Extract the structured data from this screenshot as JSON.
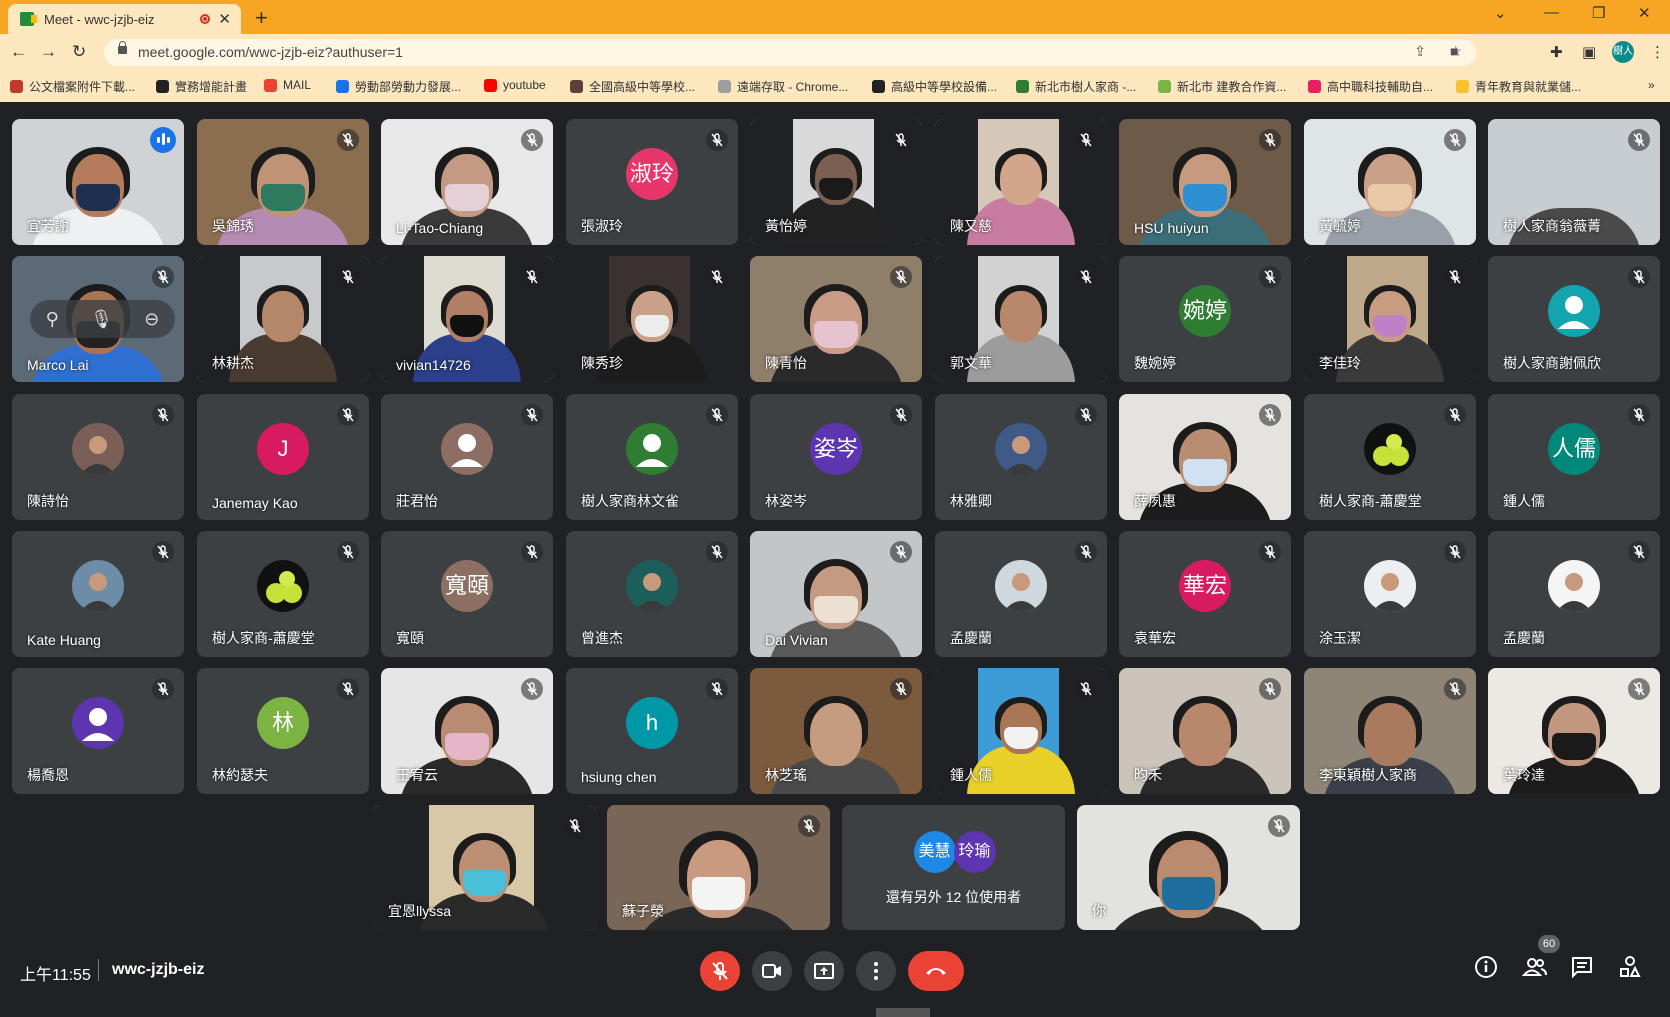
{
  "browser": {
    "tab_title": "Meet - wwc-jzjb-eiz",
    "tab_close": "✕",
    "new_tab": "+",
    "url": "meet.google.com/wwc-jzjb-eiz?authuser=1",
    "profile_initials": "樹人"
  },
  "bookmarks": [
    {
      "label": "公文檔案附件下載...",
      "color": "#c0392b"
    },
    {
      "label": "實務增能計畫",
      "color": "#222222"
    },
    {
      "label": "MAIL",
      "color": "#ea4335"
    },
    {
      "label": "勞動部勞動力發展...",
      "color": "#1a73e8"
    },
    {
      "label": "youtube",
      "color": "#ff0000"
    },
    {
      "label": "全國高級中等學校...",
      "color": "#5d4037"
    },
    {
      "label": "遠端存取 - Chrome...",
      "color": "#9e9e9e"
    },
    {
      "label": "高級中等學校設備...",
      "color": "#222222"
    },
    {
      "label": "新北市樹人家商 -...",
      "color": "#2e7d32"
    },
    {
      "label": "新北市 建教合作資...",
      "color": "#7cb342"
    },
    {
      "label": "高中職科技輔助自...",
      "color": "#e91e63"
    },
    {
      "label": "青年教育與就業儲...",
      "color": "#fbc02d"
    }
  ],
  "participants": [
    {
      "name": "宜芳謝",
      "type": "video",
      "speaking": true,
      "bg": "#cfd3d6",
      "face": "#b47b5c",
      "mask": "#1f2f4f",
      "shirt": "#eef0f2"
    },
    {
      "name": "吳錦琇",
      "type": "video",
      "bg": "#8a6e4f",
      "face": "#c09377",
      "mask": "#2f7a5e",
      "shirt": "#b48bb3"
    },
    {
      "name": "Li-Tao-Chiang",
      "type": "video",
      "bg": "#e8e8e8",
      "face": "#c49a82",
      "mask": "#e6d0d8",
      "shirt": "#3a3a3a"
    },
    {
      "name": "張淑玲",
      "type": "avatar",
      "avatar_text": "淑玲",
      "avatar_color": "#e8366b"
    },
    {
      "name": "黃怡婷",
      "type": "video",
      "bg": "#d9d9d9",
      "face": "#7a5f52",
      "mask": "#1a1a1a",
      "shirt": "#222222",
      "narrow": true
    },
    {
      "name": "陳又慈",
      "type": "video",
      "bg": "#d5c8b8",
      "face": "#d3a68b",
      "mask": "",
      "shirt": "#c87d9f",
      "narrow": true
    },
    {
      "name": "HSU huiyun",
      "type": "video",
      "bg": "#6d5a48",
      "face": "#c59a7f",
      "mask": "#2b8fd1",
      "shirt": "#3c6e7a"
    },
    {
      "name": "黃毓婷",
      "type": "video",
      "bg": "#dfe4e6",
      "face": "#caa088",
      "mask": "#e8c9a6",
      "shirt": "#9aa0a8"
    },
    {
      "name": "樹人家商翁薇菁",
      "type": "video",
      "bg": "#c8cdd2",
      "face": "",
      "mask": "",
      "shirt": "#4a4a4a"
    },
    {
      "name": "Marco Lai",
      "type": "video",
      "bg": "#5c6a78",
      "face": "#a87454",
      "mask": "#222222",
      "shirt": "#2f6fd1",
      "hover": true
    },
    {
      "name": "林耕杰",
      "type": "video",
      "bg": "#c7c9cb",
      "face": "#b4866a",
      "mask": "",
      "shirt": "#4a3b30",
      "narrow": true
    },
    {
      "name": "vivian14726",
      "type": "video",
      "bg": "#dcdcd0",
      "face": "#b07f66",
      "mask": "#111111",
      "shirt": "#2b3f8a",
      "narrow": true
    },
    {
      "name": "陳秀珍",
      "type": "video",
      "bg": "#3a3230",
      "face": "#c9a089",
      "mask": "#ececec",
      "shirt": "#1c1c1c",
      "narrow": true
    },
    {
      "name": "陳青怡",
      "type": "video",
      "bg": "#8f7e6a",
      "face": "#c99c85",
      "mask": "#e7c2cf",
      "shirt": "#2a2a2a"
    },
    {
      "name": "郭文華",
      "type": "video",
      "bg": "#d2d2d2",
      "face": "#b9876c",
      "mask": "",
      "shirt": "#9c9c9c",
      "narrow": true
    },
    {
      "name": "魏婉婷",
      "type": "avatar",
      "avatar_text": "婉婷",
      "avatar_color": "#2e7d32"
    },
    {
      "name": "李佳玲",
      "type": "video",
      "bg": "#bfa98a",
      "face": "#c79c80",
      "mask": "#c080c8",
      "shirt": "#3a3a3a",
      "narrow": true
    },
    {
      "name": "樹人家商謝佩欣",
      "type": "avatar",
      "avatar_text": "",
      "avatar_color": "#12a4af",
      "person": true
    },
    {
      "name": "陳詩怡",
      "type": "avatar",
      "avatar_text": "",
      "avatar_color": "#7b5e57",
      "photo": true
    },
    {
      "name": "Janemay Kao",
      "type": "avatar",
      "avatar_text": "J",
      "avatar_color": "#d81b60"
    },
    {
      "name": "莊君怡",
      "type": "avatar",
      "avatar_text": "",
      "avatar_color": "#8d6e63",
      "person": true
    },
    {
      "name": "樹人家商林文雀",
      "type": "avatar",
      "avatar_text": "",
      "avatar_color": "#2e7d32",
      "person": true
    },
    {
      "name": "林姿岑",
      "type": "avatar",
      "avatar_text": "姿岑",
      "avatar_color": "#5e35b1"
    },
    {
      "name": "林雅卿",
      "type": "avatar",
      "avatar_text": "",
      "avatar_color": "#3f5a86",
      "photo": true
    },
    {
      "name": "薛夙惠",
      "type": "video",
      "bg": "#e5e3e0",
      "face": "#b98d72",
      "mask": "#cfe1f2",
      "shirt": "#1c1c1c"
    },
    {
      "name": "樹人家商-蕭慶堂",
      "type": "avatar",
      "avatar_text": "",
      "avatar_color": "#111111",
      "balls": true
    },
    {
      "name": "鍾人儒",
      "type": "avatar",
      "avatar_text": "人儒",
      "avatar_color": "#00897b"
    },
    {
      "name": "Kate Huang",
      "type": "avatar",
      "avatar_text": "",
      "avatar_color": "#6d8ca8",
      "photo": true
    },
    {
      "name": "樹人家商-蕭慶堂",
      "type": "avatar",
      "avatar_text": "",
      "avatar_color": "#111111",
      "balls": true
    },
    {
      "name": "寬頤",
      "type": "avatar",
      "avatar_text": "寬頤",
      "avatar_color": "#8d6e63"
    },
    {
      "name": "曾進杰",
      "type": "avatar",
      "avatar_text": "",
      "avatar_color": "#1b5e5a",
      "photo": true
    },
    {
      "name": "Dai Vivian",
      "type": "video",
      "bg": "#c3c6c8",
      "face": "#c49a82",
      "mask": "#ece0d2",
      "shirt": "#5a5a5a"
    },
    {
      "name": "孟慶蘭",
      "type": "avatar",
      "avatar_text": "",
      "avatar_color": "#cfd8dc",
      "photo": true
    },
    {
      "name": "袁華宏",
      "type": "avatar",
      "avatar_text": "華宏",
      "avatar_color": "#d81b60"
    },
    {
      "name": "涂玉潔",
      "type": "avatar",
      "avatar_text": "",
      "avatar_color": "#eceff1",
      "photo": true
    },
    {
      "name": "孟慶蘭",
      "type": "avatar",
      "avatar_text": "",
      "avatar_color": "#f5f5f5",
      "photo": true
    },
    {
      "name": "楊喬恩",
      "type": "avatar",
      "avatar_text": "",
      "avatar_color": "#5e35b1",
      "person": true
    },
    {
      "name": "林約瑟夫",
      "type": "avatar",
      "avatar_text": "林",
      "avatar_color": "#7cb342"
    },
    {
      "name": "王宥云",
      "type": "video",
      "bg": "#e6e6e6",
      "face": "#b98b72",
      "mask": "#e4b6c8",
      "shirt": "#2a2a2a"
    },
    {
      "name": "hsiung chen",
      "type": "avatar",
      "avatar_text": "h",
      "avatar_color": "#0097a7"
    },
    {
      "name": "林芝瑤",
      "type": "video",
      "bg": "#7b5a3e",
      "face": "#c69c81",
      "mask": "",
      "shirt": "#4a4a4a"
    },
    {
      "name": "鍾人儒",
      "type": "video",
      "bg": "#3d9bd6",
      "face": "#a97655",
      "mask": "#f2f2f2",
      "shirt": "#e9d12a",
      "narrow": true
    },
    {
      "name": "昀禾",
      "type": "video",
      "bg": "#cbc4bb",
      "face": "#b8876c",
      "mask": "",
      "shirt": "#2a2a2a"
    },
    {
      "name": "李東穎樹人家商",
      "type": "video",
      "bg": "#8e8576",
      "face": "#a97a5e",
      "mask": "",
      "shirt": "#3b3f4a"
    },
    {
      "name": "葉玲達",
      "type": "video",
      "bg": "#ece9e4",
      "face": "#c29780",
      "mask": "#1a1a1a",
      "shirt": "#1c1c1c"
    },
    {
      "name": "宜恩llyssa",
      "type": "video",
      "bg": "#d8c8a8",
      "face": "#bd8f74",
      "mask": "#4ac0d8",
      "shirt": "#2a2a2a",
      "narrow": true
    },
    {
      "name": "蘇子滎",
      "type": "video",
      "bg": "#7a6656",
      "face": "#c99a80",
      "mask": "#f4f4f4",
      "shirt": "#2a2a2a"
    },
    {
      "name": "還有另外 12 位使用者",
      "type": "more",
      "avatars": [
        {
          "text": "美慧",
          "color": "#1e88e5"
        },
        {
          "text": "玲瑜",
          "color": "#5e35b1"
        }
      ]
    },
    {
      "name": "你",
      "type": "video",
      "bg": "#e2e2de",
      "face": "#bb8b70",
      "mask": "#1e6fa0",
      "shirt": "#2a2a2a"
    }
  ],
  "bottom": {
    "time": "上午11:55",
    "meeting_code": "wwc-jzjb-eiz",
    "people_count": "60"
  },
  "colors": {
    "leave": "#ea4335",
    "mic_off": "#ea4335",
    "tile": "#3c4043",
    "speaking": "#8ab4f8"
  }
}
